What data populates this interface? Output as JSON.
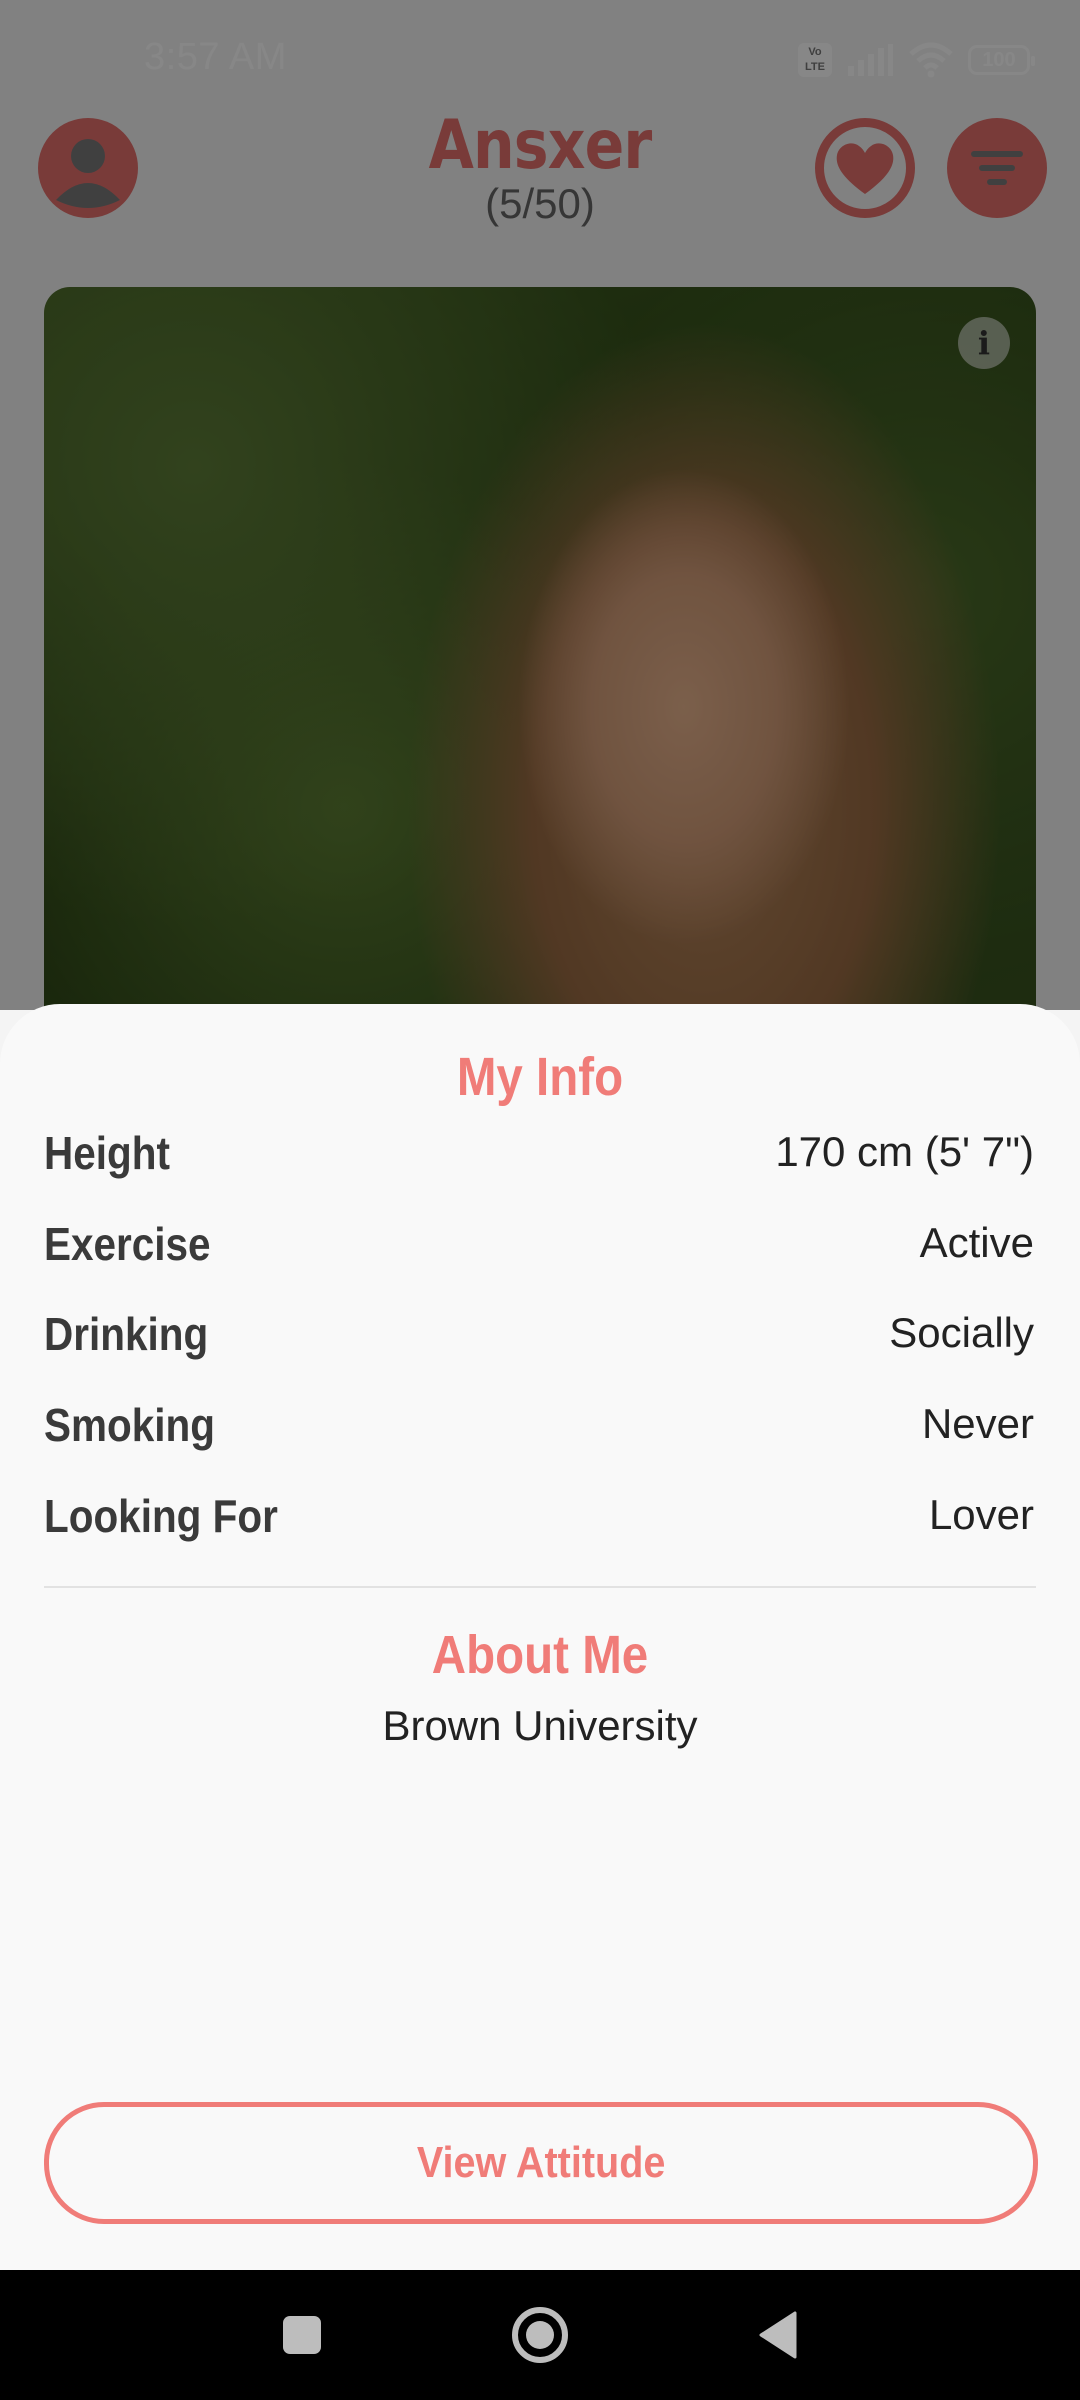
{
  "status_bar": {
    "time": "3:57 AM",
    "volte_label": "Vo LTE",
    "battery_level": "100"
  },
  "header": {
    "title": "Ansxer",
    "count": "(5/50)"
  },
  "photo": {
    "info_icon_glyph": "i"
  },
  "my_info": {
    "title": "My Info",
    "rows": [
      {
        "label": "Height",
        "value": "170 cm (5' 7\")"
      },
      {
        "label": "Exercise",
        "value": "Active"
      },
      {
        "label": "Drinking",
        "value": "Socially"
      },
      {
        "label": "Smoking",
        "value": "Never"
      },
      {
        "label": "Looking For",
        "value": "Lover"
      }
    ]
  },
  "about_me": {
    "title": "About Me",
    "text": "Brown University"
  },
  "actions": {
    "view_attitude_label": "View Attitude"
  },
  "colors": {
    "accent": "#f07c78",
    "accent_dimmed": "#e4706d",
    "sheet_background": "#f9f9f9",
    "nav_background": "#000000"
  },
  "icons": [
    "profile-icon",
    "heart-icon",
    "filter-icon",
    "info-icon",
    "square-nav-icon",
    "home-circle-icon",
    "back-triangle-icon"
  ]
}
